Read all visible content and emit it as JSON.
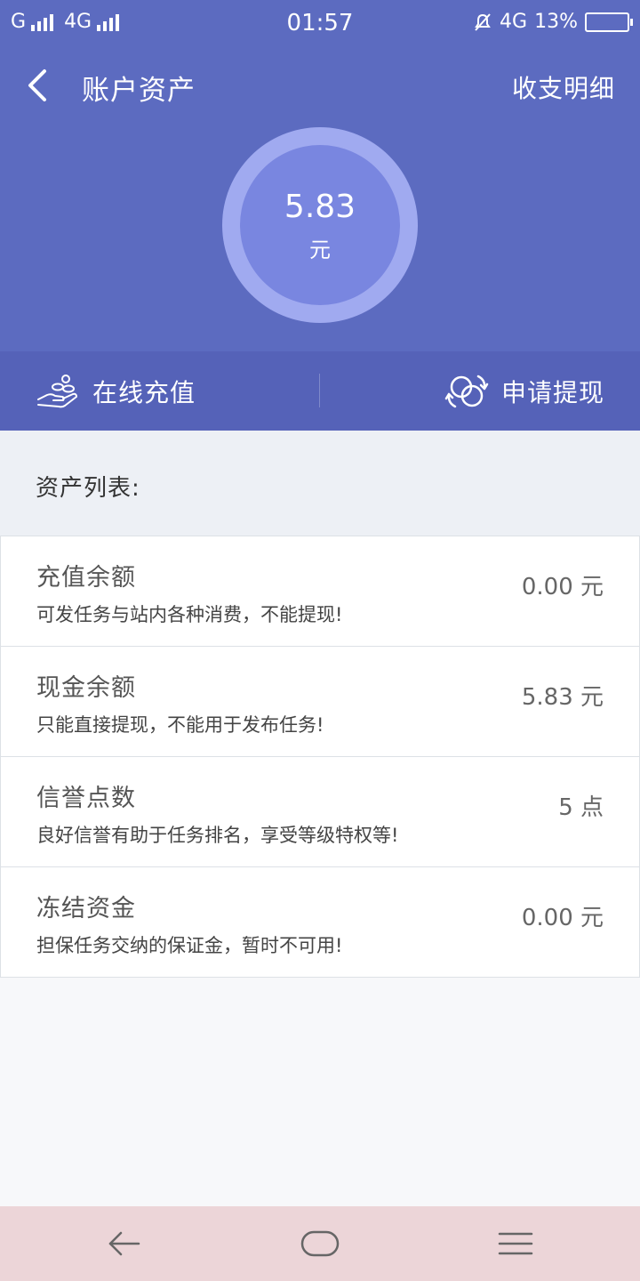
{
  "status_bar": {
    "carrier1": "G",
    "carrier2": "4G",
    "time": "01:57",
    "network2": "4G",
    "battery": "13%"
  },
  "header": {
    "title": "账户资产",
    "detail_link": "收支明细",
    "amount": "5.83",
    "unit": "元"
  },
  "actions": {
    "recharge_label": "在线充值",
    "withdraw_label": "申请提现"
  },
  "list_title": "资产列表:",
  "assets": [
    {
      "name": "充值余额",
      "desc": "可发任务与站内各种消费，不能提现!",
      "value": "0.00 元"
    },
    {
      "name": "现金余额",
      "desc": "只能直接提现，不能用于发布任务!",
      "value": "5.83 元"
    },
    {
      "name": "信誉点数",
      "desc": "良好信誉有助于任务排名，享受等级特权等!",
      "value": "5 点"
    },
    {
      "name": "冻结资金",
      "desc": "担保任务交纳的保证金，暂时不可用!",
      "value": "0.00 元"
    }
  ],
  "colors": {
    "header_bg": "#5c6bc0",
    "ring_outer": "#a0aaf0",
    "ring_inner": "#7986e0",
    "action_bar_bg": "#5562b8",
    "nav_bar_bg": "#ecd5d8"
  },
  "icons": {
    "back": "chevron-left-icon",
    "recharge": "coin-hand-icon",
    "withdraw": "exchange-icon",
    "nav_back": "arrow-left-icon",
    "nav_home": "rounded-rect-icon",
    "nav_menu": "hamburger-icon"
  }
}
